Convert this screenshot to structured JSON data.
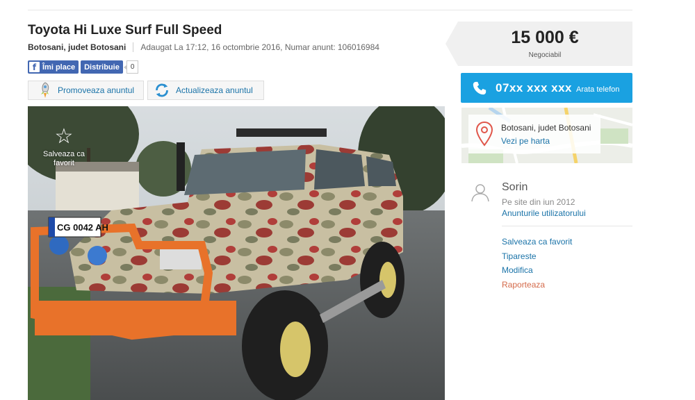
{
  "listing": {
    "title": "Toyota Hi Luxe Surf Full Speed",
    "location": "Botosani, judet Botosani",
    "info": "Adaugat La 17:12, 16 octombrie 2016, Numar anunt: 106016984"
  },
  "social": {
    "like_label": "Îmi place",
    "share_label": "Distribuie",
    "share_count": "0"
  },
  "actions": {
    "promote_label": "Promoveaza anuntul",
    "update_label": "Actualizeaza anuntul"
  },
  "photo": {
    "favorite_label": "Salveaza ca favorit",
    "plate_text": "CG 0042 AH"
  },
  "price": {
    "value": "15 000 €",
    "negotiable": "Negociabil"
  },
  "phone": {
    "number": "07xx xxx xxx",
    "show_label": "Arata telefon"
  },
  "map": {
    "location": "Botosani, judet Botosani",
    "link_label": "Vezi pe harta"
  },
  "seller": {
    "name": "Sorin",
    "since": "Pe site din iun 2012",
    "ads_link": "Anunturile utilizatorului"
  },
  "side_links": {
    "favorite": "Salveaza ca favorit",
    "print": "Tipareste",
    "edit": "Modifica",
    "report": "Raporteaza"
  },
  "colors": {
    "accent": "#1aa1e1",
    "link": "#1a73a8",
    "report": "#d46a4a",
    "facebook": "#4267b2"
  }
}
